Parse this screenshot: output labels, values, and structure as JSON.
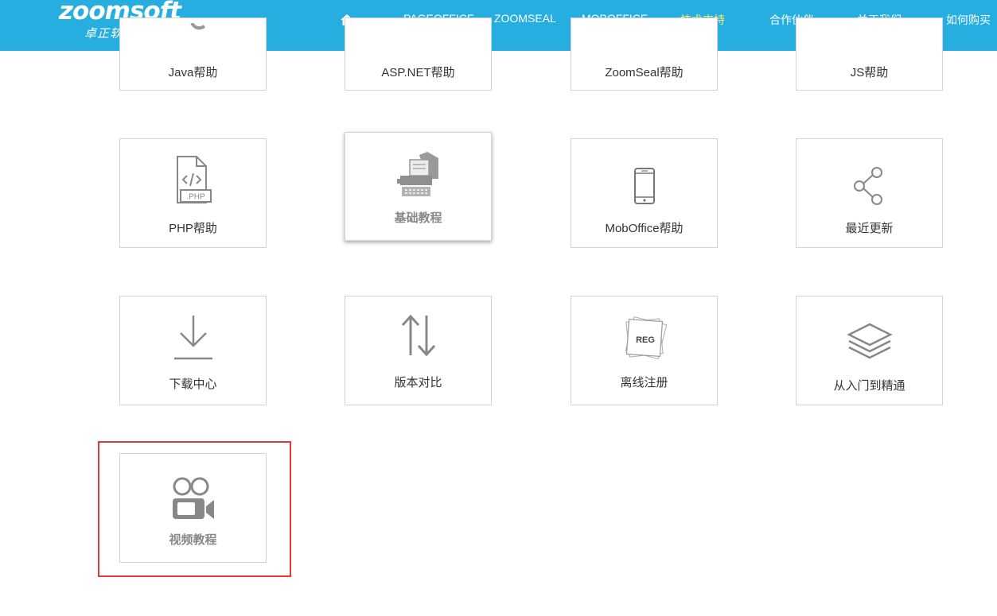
{
  "nav": {
    "logo_main": "zoomsoft",
    "logo_sub": "卓正软件",
    "items": [
      "PAGEOFFICE",
      "ZOOMSEAL",
      "MOBOFFICE",
      "技术支持",
      "合作伙伴",
      "关于我们",
      "如何购买"
    ],
    "active_item": "技术支持",
    "bg_color": "#26aee0",
    "active_color": "#f8f36b"
  },
  "cards": [
    {
      "label": "Java帮助",
      "icon": "java-icon"
    },
    {
      "label": "ASP.NET帮助",
      "icon": "none"
    },
    {
      "label": "ZoomSeal帮助",
      "icon": "none"
    },
    {
      "label": "JS帮助",
      "icon": "none"
    },
    {
      "label": "PHP帮助",
      "icon": "php-file-icon"
    },
    {
      "label": "基础教程",
      "icon": "typewriter-icon"
    },
    {
      "label": "MobOffice帮助",
      "icon": "phone-icon"
    },
    {
      "label": "最近更新",
      "icon": "share-icon"
    },
    {
      "label": "下载中心",
      "icon": "download-icon"
    },
    {
      "label": "版本对比",
      "icon": "compare-arrows-icon"
    },
    {
      "label": "离线注册",
      "icon": "reg-icon"
    },
    {
      "label": "从入门到精通",
      "icon": "layers-icon"
    },
    {
      "label": "视频教程",
      "icon": "video-camera-icon"
    }
  ],
  "reg_icon_text": "REG",
  "php_icon_text": ".PHP",
  "highlight_color": "#e23b35"
}
